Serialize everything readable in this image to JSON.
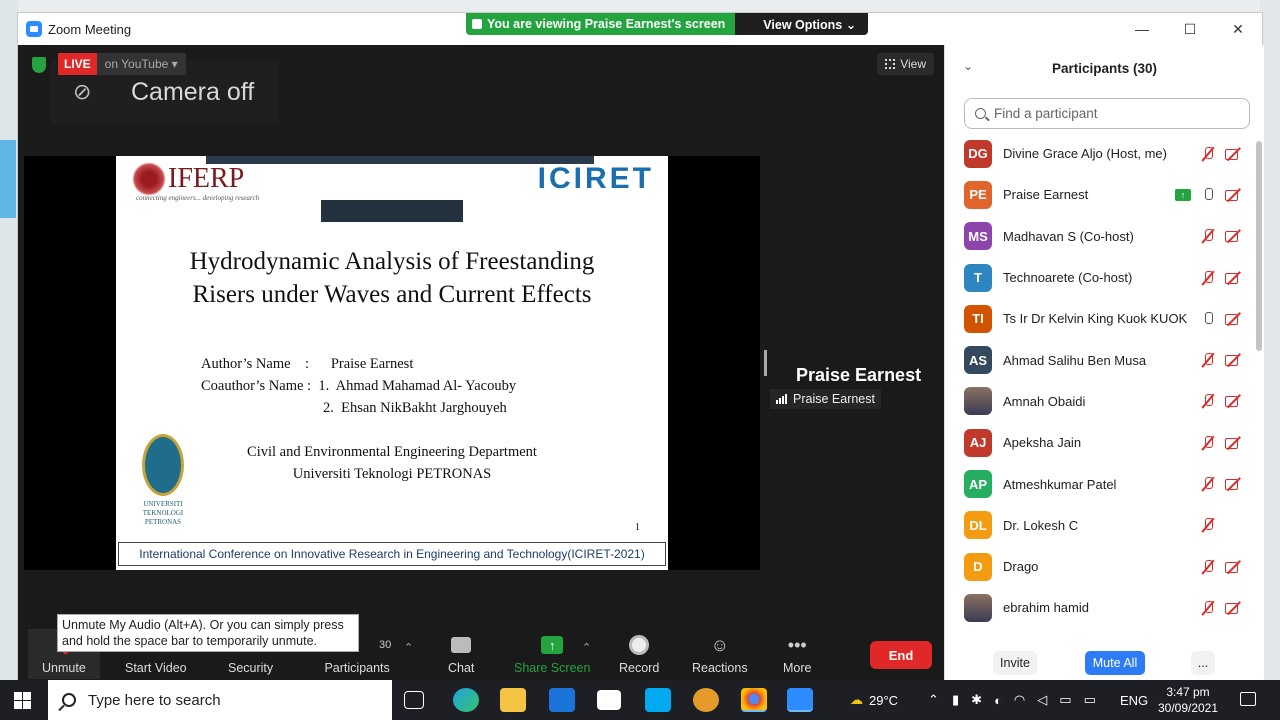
{
  "window": {
    "title": "Zoom Meeting",
    "minimize": "—",
    "maximize": "☐",
    "close": "✕"
  },
  "banner": {
    "viewing_text": "You are viewing Praise Earnest's screen",
    "view_options": "View Options ⌄"
  },
  "video": {
    "live_label": "LIVE",
    "live_platform": "on YouTube ▾",
    "camera_off_text": "Camera off",
    "view_label": "View",
    "presenter_name": "Praise Earnest",
    "presenter_tag": "Praise Earnest"
  },
  "slide": {
    "org_logo": "IFERP",
    "org_tagline": "connecting engineers... developing research",
    "conf_logo": "ICIRET",
    "title_line1": "Hydrodynamic Analysis of Freestanding",
    "title_line2": "Risers under Waves and Current Effects",
    "author_line": "Author’s Name    :      Praise Earnest",
    "coauthor_line1": "Coauthor’s Name :  1.  Ahmad Mahamad Al- Yacouby",
    "coauthor_line2": "2.  Ehsan NikBakht Jarghouyeh",
    "dept_line1": "Civil and Environmental Engineering Department",
    "dept_line2": "Universiti Teknologi PETRONAS",
    "uni_logo_text": "UNIVERSITI TEKNOLOGI PETRONAS",
    "page_number": "1",
    "footer": "International Conference on Innovative Research in Engineering and Technology(ICIRET-2021)"
  },
  "toolbar": {
    "unmute": "Unmute",
    "start_video": "Start Video",
    "security": "Security",
    "participants": "Participants",
    "participants_count": "30",
    "chat": "Chat",
    "share_screen": "Share Screen",
    "record": "Record",
    "reactions": "Reactions",
    "more": "More",
    "end": "End",
    "tooltip": "Unmute My Audio (Alt+A). Or you can simply press and hold the space bar to temporarily unmute."
  },
  "panel": {
    "title": "Participants (30)",
    "search_placeholder": "Find a participant",
    "participants": [
      {
        "initials": "DG",
        "name": "Divine Grace Aljo (Host, me)",
        "color": "#c0392b",
        "mic": "off",
        "cam": "off"
      },
      {
        "initials": "PE",
        "name": "Praise Earnest",
        "color": "#e0642b",
        "mic": "on",
        "cam": "off",
        "sharing": true
      },
      {
        "initials": "MS",
        "name": "Madhavan S (Co-host)",
        "color": "#8e44ad",
        "mic": "off",
        "cam": "off"
      },
      {
        "initials": "T",
        "name": "Technoarete (Co-host)",
        "color": "#2e86c1",
        "mic": "off",
        "cam": "off"
      },
      {
        "initials": "TI",
        "name": "Ts Ir Dr Kelvin King Kuok KUOK",
        "color": "#d35400",
        "mic": "on",
        "cam": "off"
      },
      {
        "initials": "AS",
        "name": "Ahmad Salihu Ben Musa",
        "color": "#34495e",
        "mic": "off",
        "cam": "off"
      },
      {
        "initials": "",
        "name": "Amnah Obaidi",
        "color": "photo",
        "mic": "off",
        "cam": "off"
      },
      {
        "initials": "AJ",
        "name": "Apeksha Jain",
        "color": "#c0392b",
        "mic": "off",
        "cam": "off"
      },
      {
        "initials": "AP",
        "name": "Atmeshkumar Patel",
        "color": "#27ae60",
        "mic": "off",
        "cam": "off"
      },
      {
        "initials": "DL",
        "name": "Dr. Lokesh C",
        "color": "#f39c12",
        "mic": "off",
        "cam": "none"
      },
      {
        "initials": "D",
        "name": "Drago",
        "color": "#f39c12",
        "mic": "off",
        "cam": "off"
      },
      {
        "initials": "",
        "name": "ebrahim hamid",
        "color": "photo",
        "mic": "off",
        "cam": "off"
      }
    ],
    "invite": "Invite",
    "mute_all": "Mute All",
    "more": "..."
  },
  "taskbar": {
    "search_placeholder": "Type here to search",
    "weather": "29°C",
    "language": "ENG",
    "time": "3:47 pm",
    "date": "30/09/2021"
  }
}
